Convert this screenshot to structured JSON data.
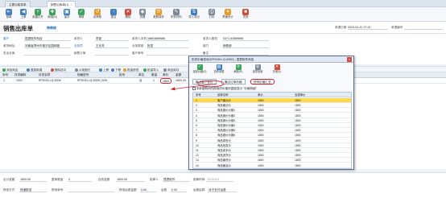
{
  "tabs": [
    {
      "label": "主要功能菜单"
    },
    {
      "label": "销售出库单(1)"
    }
  ],
  "toolbar": [
    {
      "label": "首单",
      "icon": "first-icon"
    },
    {
      "label": "上单",
      "icon": "prev-icon"
    },
    {
      "label": "新建打开",
      "icon": "new-icon"
    },
    {
      "label": "新增(N)",
      "icon": "add-icon"
    },
    {
      "label": "保存",
      "icon": "save-icon"
    },
    {
      "label": "审核",
      "icon": "check-icon"
    },
    {
      "label": "反审核",
      "icon": "uncheck-icon"
    },
    {
      "label": "提交",
      "icon": "submit-icon"
    },
    {
      "label": "删除",
      "icon": "delete-icon"
    },
    {
      "label": "查看",
      "icon": "view-icon"
    },
    {
      "label": "更新操作",
      "icon": "update-icon"
    },
    {
      "label": "附件材料",
      "icon": "attach-icon"
    },
    {
      "label": "导入导出",
      "icon": "import-icon"
    },
    {
      "label": "打印",
      "icon": "print-icon"
    },
    {
      "label": "界面设计",
      "icon": "design-icon"
    },
    {
      "label": "关闭",
      "icon": "close-icon"
    }
  ],
  "header": {
    "title": "销售出库单",
    "status": "待审核",
    "date_label": "单据日期",
    "date_value": "2023-04-11 17:13",
    "no_label": "单据编号"
  },
  "form": {
    "customer_label": "客户",
    "customer_value": "昆君软件科技",
    "address_label": "收货地址",
    "address_value": "河南省郑州市惠济区园林路",
    "settle_label": "发出仓库",
    "contact_label": "收货人",
    "contact_value": "李如",
    "salesman_label": "业务员",
    "salesman_value": "王业务",
    "phone_label": "收货人手机",
    "phone_value": "16803689686",
    "dept_label": "部门",
    "dept_value": "销售部",
    "tel_label": "收货人座机",
    "tel_value": "0371-63569898",
    "order_label": "销售订单",
    "ship_label": "业务类型",
    "ship_value": "批发",
    "remark_label": "备注",
    "ticket_label": "客户单号"
  },
  "subbar": [
    "添加商品",
    "复制新增",
    "删除选中",
    "从前面行",
    "上移",
    "下移",
    "批量修改",
    "批量导入",
    "商品库存",
    "历史价格",
    "配置表格"
  ],
  "grid": {
    "headers": [
      "序号",
      "存货编码",
      "存货名称",
      "规格型号",
      "批号",
      "单位",
      "数量",
      "单价",
      "金额",
      "税率"
    ],
    "rows": [
      [
        "1",
        "1001",
        "EPSON LQ-630K",
        "EPSON LQ-630K | 62K",
        "",
        "台",
        "1",
        "1800",
        "1800.00",
        ""
      ]
    ]
  },
  "footer": {
    "total_label": "合计金额",
    "total_value": "1800.00",
    "qty_label": "整单数量",
    "qty_value": "0",
    "paid_label": "应收金额",
    "paid_value": "1800.00",
    "maker_label": "制单人",
    "maker_value": "昆君软件",
    "make_date_label": "制单时间",
    "make_date_value": "2023/4/11",
    "logistics_label": "物流方式",
    "logistics_value": "快递配送",
    "shipno_label": "物流单号",
    "shipfee_label": "物流运费金额",
    "shipfee_value": "0.00",
    "shipfee2_label": "运费",
    "shipfee2_value": "0.00",
    "bill_label": "运费结算",
    "bill_value": "对方支付运费"
  },
  "popup": {
    "title": "历史价格查询 [EPSON LQ-630K] - 昆君软件科技",
    "buttons": [
      "选择价格(S)",
      "查看单据",
      "刷新(R)",
      "选项设置",
      "关闭(X)"
    ],
    "tabs": [
      "最近客户售价",
      "最近订单价格",
      "所有价格汇总"
    ],
    "note": "本单据期间内使用的价格则直接显示 \"价格明细\"",
    "headers": [
      "序号",
      "品种名称",
      "单价",
      "含税单价"
    ],
    "rows": [
      [
        "1",
        "客户最近价",
        "1800",
        "1800"
      ],
      [
        "2",
        "商品最近价",
        "1800",
        "1800"
      ],
      [
        "3",
        "商品报价价格1",
        "1800",
        "1800"
      ],
      [
        "4",
        "商品报价价格2",
        "1800",
        "1800"
      ],
      [
        "5",
        "商品报价价格3",
        "1800",
        "1800"
      ],
      [
        "6",
        "商品报价价格4",
        "1800",
        "1800"
      ],
      [
        "7",
        "商品报价价格5",
        "1800",
        "1800"
      ],
      [
        "8",
        "商品报价价格6",
        "1800",
        "1800"
      ],
      [
        "9",
        "商品零售价",
        "1800",
        "1800"
      ],
      [
        "10",
        "商品批发价",
        "1800",
        "1800"
      ],
      [
        "11",
        "商品成本价",
        "1800",
        "1800"
      ],
      [
        "12",
        "商品进货价",
        "1800",
        "1800"
      ],
      [
        "13",
        "商品最低价",
        "1800",
        "1800"
      ],
      [
        "14",
        "商品最高价",
        "1800",
        "1800"
      ]
    ]
  },
  "colors": {
    "accent": "#3f7fc4",
    "highlight": "#ffd84a",
    "annotation": "#d0202a"
  }
}
